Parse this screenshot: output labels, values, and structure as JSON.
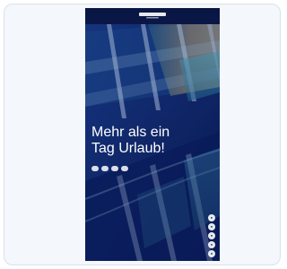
{
  "header": {
    "left_nav": "",
    "right_nav": ""
  },
  "hero": {
    "headline_line1": "Mehr als ein",
    "headline_line2": "Tag Urlaub!",
    "subline": ""
  },
  "buttons": [
    {
      "label": ""
    },
    {
      "label": ""
    },
    {
      "label": ""
    },
    {
      "label": ""
    }
  ],
  "social_icons": [
    "circle-icon",
    "circle-icon",
    "circle-icon",
    "circle-icon",
    "circle-icon"
  ],
  "colors": {
    "background": "#ffffff",
    "card": "#f4f7fb",
    "brand_navy": "#0c1d55",
    "text": "#ffffff"
  }
}
